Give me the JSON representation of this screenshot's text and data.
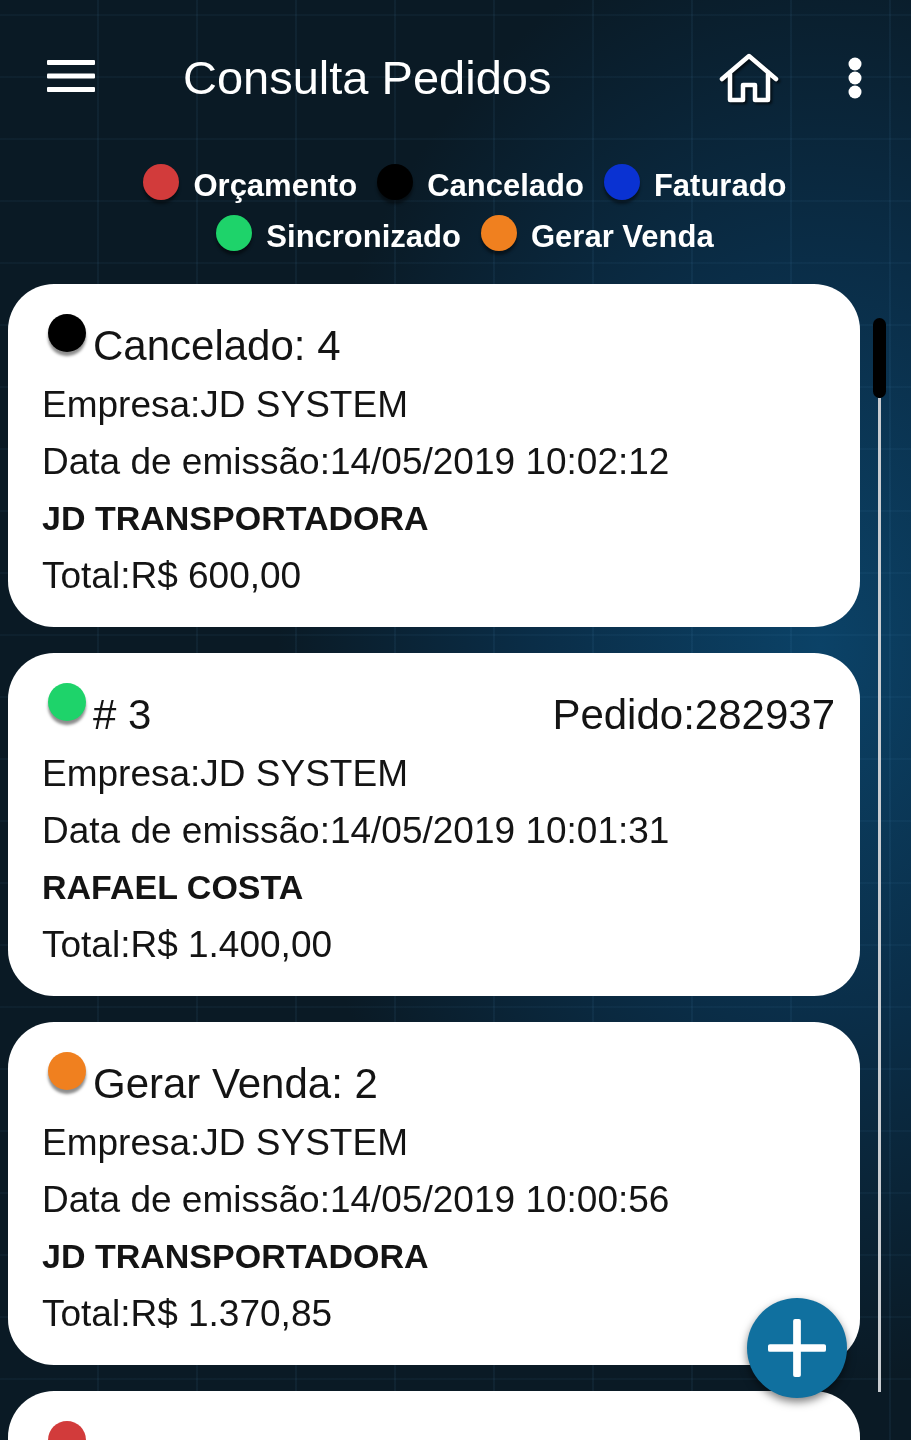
{
  "app_bar": {
    "title": "Consulta Pedidos"
  },
  "legend": [
    {
      "label": "Orçamento",
      "color": "#d23b3b"
    },
    {
      "label": "Cancelado",
      "color": "#000000"
    },
    {
      "label": "Faturado",
      "color": "#0a32d2"
    },
    {
      "label": "Sincronizado",
      "color": "#1ed36a"
    },
    {
      "label": "Gerar Venda",
      "color": "#f0801f"
    }
  ],
  "orders": [
    {
      "color": "#000000",
      "heading": "Cancelado: 4",
      "company": "Empresa:JD SYSTEM",
      "issued": "Data de emissão:14/05/2019 10:02:12",
      "customer": "JD TRANSPORTADORA",
      "total": "Total:R$ 600,00"
    },
    {
      "color": "#1ed36a",
      "heading": "# 3",
      "order_number": "Pedido:282937",
      "company": "Empresa:JD SYSTEM",
      "issued": "Data de emissão:14/05/2019 10:01:31",
      "customer": "RAFAEL COSTA",
      "total": "Total:R$ 1.400,00"
    },
    {
      "color": "#f0801f",
      "heading": "Gerar Venda: 2",
      "company": "Empresa:JD SYSTEM",
      "issued": "Data de emissão:14/05/2019 10:00:56",
      "customer": "JD TRANSPORTADORA",
      "total": "Total:R$ 1.370,85"
    },
    {
      "color": "#d23b3b"
    }
  ]
}
